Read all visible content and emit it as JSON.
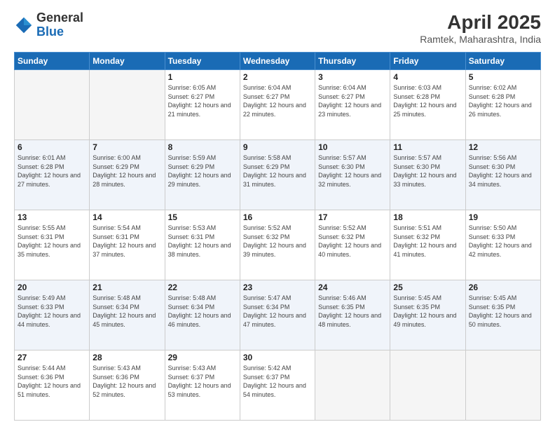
{
  "header": {
    "logo_general": "General",
    "logo_blue": "Blue",
    "month_title": "April 2025",
    "location": "Ramtek, Maharashtra, India"
  },
  "days_of_week": [
    "Sunday",
    "Monday",
    "Tuesday",
    "Wednesday",
    "Thursday",
    "Friday",
    "Saturday"
  ],
  "weeks": [
    [
      {
        "day": "",
        "sunrise": "",
        "sunset": "",
        "daylight": "",
        "empty": true
      },
      {
        "day": "",
        "sunrise": "",
        "sunset": "",
        "daylight": "",
        "empty": true
      },
      {
        "day": "1",
        "sunrise": "Sunrise: 6:05 AM",
        "sunset": "Sunset: 6:27 PM",
        "daylight": "Daylight: 12 hours and 21 minutes.",
        "empty": false
      },
      {
        "day": "2",
        "sunrise": "Sunrise: 6:04 AM",
        "sunset": "Sunset: 6:27 PM",
        "daylight": "Daylight: 12 hours and 22 minutes.",
        "empty": false
      },
      {
        "day": "3",
        "sunrise": "Sunrise: 6:04 AM",
        "sunset": "Sunset: 6:27 PM",
        "daylight": "Daylight: 12 hours and 23 minutes.",
        "empty": false
      },
      {
        "day": "4",
        "sunrise": "Sunrise: 6:03 AM",
        "sunset": "Sunset: 6:28 PM",
        "daylight": "Daylight: 12 hours and 25 minutes.",
        "empty": false
      },
      {
        "day": "5",
        "sunrise": "Sunrise: 6:02 AM",
        "sunset": "Sunset: 6:28 PM",
        "daylight": "Daylight: 12 hours and 26 minutes.",
        "empty": false
      }
    ],
    [
      {
        "day": "6",
        "sunrise": "Sunrise: 6:01 AM",
        "sunset": "Sunset: 6:28 PM",
        "daylight": "Daylight: 12 hours and 27 minutes.",
        "empty": false
      },
      {
        "day": "7",
        "sunrise": "Sunrise: 6:00 AM",
        "sunset": "Sunset: 6:29 PM",
        "daylight": "Daylight: 12 hours and 28 minutes.",
        "empty": false
      },
      {
        "day": "8",
        "sunrise": "Sunrise: 5:59 AM",
        "sunset": "Sunset: 6:29 PM",
        "daylight": "Daylight: 12 hours and 29 minutes.",
        "empty": false
      },
      {
        "day": "9",
        "sunrise": "Sunrise: 5:58 AM",
        "sunset": "Sunset: 6:29 PM",
        "daylight": "Daylight: 12 hours and 31 minutes.",
        "empty": false
      },
      {
        "day": "10",
        "sunrise": "Sunrise: 5:57 AM",
        "sunset": "Sunset: 6:30 PM",
        "daylight": "Daylight: 12 hours and 32 minutes.",
        "empty": false
      },
      {
        "day": "11",
        "sunrise": "Sunrise: 5:57 AM",
        "sunset": "Sunset: 6:30 PM",
        "daylight": "Daylight: 12 hours and 33 minutes.",
        "empty": false
      },
      {
        "day": "12",
        "sunrise": "Sunrise: 5:56 AM",
        "sunset": "Sunset: 6:30 PM",
        "daylight": "Daylight: 12 hours and 34 minutes.",
        "empty": false
      }
    ],
    [
      {
        "day": "13",
        "sunrise": "Sunrise: 5:55 AM",
        "sunset": "Sunset: 6:31 PM",
        "daylight": "Daylight: 12 hours and 35 minutes.",
        "empty": false
      },
      {
        "day": "14",
        "sunrise": "Sunrise: 5:54 AM",
        "sunset": "Sunset: 6:31 PM",
        "daylight": "Daylight: 12 hours and 37 minutes.",
        "empty": false
      },
      {
        "day": "15",
        "sunrise": "Sunrise: 5:53 AM",
        "sunset": "Sunset: 6:31 PM",
        "daylight": "Daylight: 12 hours and 38 minutes.",
        "empty": false
      },
      {
        "day": "16",
        "sunrise": "Sunrise: 5:52 AM",
        "sunset": "Sunset: 6:32 PM",
        "daylight": "Daylight: 12 hours and 39 minutes.",
        "empty": false
      },
      {
        "day": "17",
        "sunrise": "Sunrise: 5:52 AM",
        "sunset": "Sunset: 6:32 PM",
        "daylight": "Daylight: 12 hours and 40 minutes.",
        "empty": false
      },
      {
        "day": "18",
        "sunrise": "Sunrise: 5:51 AM",
        "sunset": "Sunset: 6:32 PM",
        "daylight": "Daylight: 12 hours and 41 minutes.",
        "empty": false
      },
      {
        "day": "19",
        "sunrise": "Sunrise: 5:50 AM",
        "sunset": "Sunset: 6:33 PM",
        "daylight": "Daylight: 12 hours and 42 minutes.",
        "empty": false
      }
    ],
    [
      {
        "day": "20",
        "sunrise": "Sunrise: 5:49 AM",
        "sunset": "Sunset: 6:33 PM",
        "daylight": "Daylight: 12 hours and 44 minutes.",
        "empty": false
      },
      {
        "day": "21",
        "sunrise": "Sunrise: 5:48 AM",
        "sunset": "Sunset: 6:34 PM",
        "daylight": "Daylight: 12 hours and 45 minutes.",
        "empty": false
      },
      {
        "day": "22",
        "sunrise": "Sunrise: 5:48 AM",
        "sunset": "Sunset: 6:34 PM",
        "daylight": "Daylight: 12 hours and 46 minutes.",
        "empty": false
      },
      {
        "day": "23",
        "sunrise": "Sunrise: 5:47 AM",
        "sunset": "Sunset: 6:34 PM",
        "daylight": "Daylight: 12 hours and 47 minutes.",
        "empty": false
      },
      {
        "day": "24",
        "sunrise": "Sunrise: 5:46 AM",
        "sunset": "Sunset: 6:35 PM",
        "daylight": "Daylight: 12 hours and 48 minutes.",
        "empty": false
      },
      {
        "day": "25",
        "sunrise": "Sunrise: 5:45 AM",
        "sunset": "Sunset: 6:35 PM",
        "daylight": "Daylight: 12 hours and 49 minutes.",
        "empty": false
      },
      {
        "day": "26",
        "sunrise": "Sunrise: 5:45 AM",
        "sunset": "Sunset: 6:35 PM",
        "daylight": "Daylight: 12 hours and 50 minutes.",
        "empty": false
      }
    ],
    [
      {
        "day": "27",
        "sunrise": "Sunrise: 5:44 AM",
        "sunset": "Sunset: 6:36 PM",
        "daylight": "Daylight: 12 hours and 51 minutes.",
        "empty": false
      },
      {
        "day": "28",
        "sunrise": "Sunrise: 5:43 AM",
        "sunset": "Sunset: 6:36 PM",
        "daylight": "Daylight: 12 hours and 52 minutes.",
        "empty": false
      },
      {
        "day": "29",
        "sunrise": "Sunrise: 5:43 AM",
        "sunset": "Sunset: 6:37 PM",
        "daylight": "Daylight: 12 hours and 53 minutes.",
        "empty": false
      },
      {
        "day": "30",
        "sunrise": "Sunrise: 5:42 AM",
        "sunset": "Sunset: 6:37 PM",
        "daylight": "Daylight: 12 hours and 54 minutes.",
        "empty": false
      },
      {
        "day": "",
        "sunrise": "",
        "sunset": "",
        "daylight": "",
        "empty": true
      },
      {
        "day": "",
        "sunrise": "",
        "sunset": "",
        "daylight": "",
        "empty": true
      },
      {
        "day": "",
        "sunrise": "",
        "sunset": "",
        "daylight": "",
        "empty": true
      }
    ]
  ]
}
